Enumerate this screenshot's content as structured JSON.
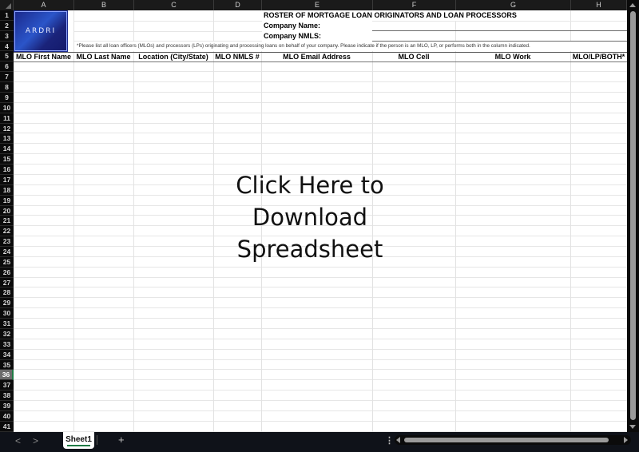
{
  "columns": [
    "A",
    "B",
    "C",
    "D",
    "E",
    "F",
    "G",
    "H"
  ],
  "rows": [
    "1",
    "2",
    "3",
    "4",
    "5",
    "6",
    "7",
    "8",
    "9",
    "10",
    "11",
    "12",
    "13",
    "14",
    "15",
    "16",
    "17",
    "18",
    "19",
    "20",
    "21",
    "22",
    "23",
    "24",
    "25",
    "26",
    "27",
    "28",
    "29",
    "30",
    "31",
    "32",
    "33",
    "34",
    "35",
    "36",
    "37",
    "38",
    "39",
    "40",
    "41"
  ],
  "selected_row": "36",
  "logo": {
    "text": "ARDRI"
  },
  "sheet": {
    "title": "ROSTER OF MORTGAGE LOAN ORIGINATORS AND LOAN PROCESSORS",
    "company_name_label": "Company Name:",
    "company_nmls_label": "Company NMLS:",
    "instructions": "*Please list all loan officers (MLOs) and processors (LPs) originating and processing loans on behalf of your company.  Please indicate if the person is an MLO, LP, or performs both in the column indicated.",
    "headers": [
      "MLO First Name",
      "MLO Last Name",
      "Location (City/State)",
      "MLO NMLS #",
      "MLO Email Address",
      "MLO Cell",
      "MLO Work",
      "MLO/LP/BOTH*"
    ]
  },
  "overlay": {
    "download_link": "Click Here to Download Spreadsheet"
  },
  "bottom_bar": {
    "sheet_tabs": [
      "Sheet1"
    ],
    "active_sheet": "Sheet1",
    "add_sheet_label": "+",
    "prev_label": "<",
    "next_label": ">",
    "more_label": "⋮"
  }
}
